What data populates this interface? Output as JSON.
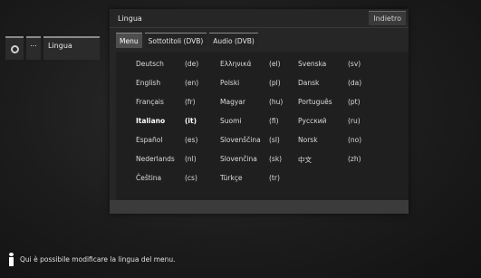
{
  "breadcrumb": {
    "dots": "...",
    "label": "Lingua"
  },
  "dialog": {
    "title": "Lingua",
    "back_label": "Indietro"
  },
  "tabs": [
    {
      "label": "Menu",
      "active": true
    },
    {
      "label": "Sottotitoli (DVB)",
      "active": false
    },
    {
      "label": "Audio (DVB)",
      "active": false
    }
  ],
  "languages": [
    {
      "name": "Deutsch",
      "code": "(de)"
    },
    {
      "name": "English",
      "code": "(en)"
    },
    {
      "name": "Français",
      "code": "(fr)"
    },
    {
      "name": "Italiano",
      "code": "(it)",
      "selected": true
    },
    {
      "name": "Español",
      "code": "(es)"
    },
    {
      "name": "Nederlands",
      "code": "(nl)"
    },
    {
      "name": "Čeština",
      "code": "(cs)"
    },
    {
      "name": "Ελληνικά",
      "code": "(el)"
    },
    {
      "name": "Polski",
      "code": "(pl)"
    },
    {
      "name": "Magyar",
      "code": "(hu)"
    },
    {
      "name": "Suomi",
      "code": "(fi)"
    },
    {
      "name": "Slovenščina",
      "code": "(sl)"
    },
    {
      "name": "Slovenčina",
      "code": "(sk)"
    },
    {
      "name": "Türkçe",
      "code": "(tr)"
    },
    {
      "name": "Svenska",
      "code": "(sv)"
    },
    {
      "name": "Dansk",
      "code": "(da)"
    },
    {
      "name": "Português",
      "code": "(pt)"
    },
    {
      "name": "Русский",
      "code": "(ru)"
    },
    {
      "name": "Norsk",
      "code": "(no)"
    },
    {
      "name": "中文",
      "code": "(zh)"
    }
  ],
  "info_text": "Qui è possibile modificare la lingua del menu."
}
